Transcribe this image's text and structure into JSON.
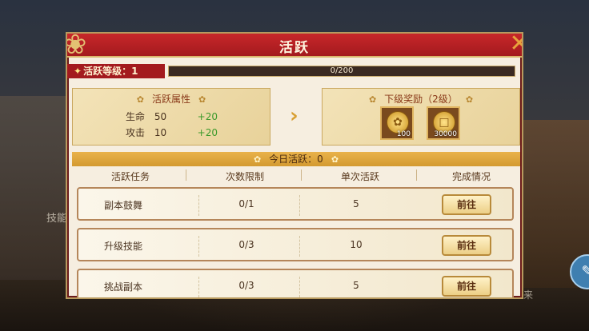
{
  "panel": {
    "title": "活跃",
    "close_icon": "close-x-icon"
  },
  "level": {
    "label": "活跃等级：1",
    "progress_text": "0/200",
    "progress_fraction": 0.0
  },
  "attributes": {
    "title": "活跃属性",
    "rows": [
      {
        "name": "生命",
        "value": "50",
        "increase": "+20"
      },
      {
        "name": "攻击",
        "value": "10",
        "increase": "+20"
      }
    ]
  },
  "rewards": {
    "title": "下级奖励（2级）",
    "items": [
      {
        "icon": "gold-flower-coin-icon",
        "quantity": "100"
      },
      {
        "icon": "gold-square-coin-icon",
        "quantity": "30000"
      }
    ]
  },
  "today": {
    "label": "今日活跃：0"
  },
  "table": {
    "headers": [
      "活跃任务",
      "次数限制",
      "单次活跃",
      "完成情况"
    ],
    "rows": [
      {
        "task": "副本鼓舞",
        "limit": "0/1",
        "points": "5",
        "action": "前往"
      },
      {
        "task": "升级技能",
        "limit": "0/3",
        "points": "10",
        "action": "前往"
      },
      {
        "task": "挑战副本",
        "limit": "0/3",
        "points": "5",
        "action": "前往"
      }
    ]
  },
  "background": {
    "side_text_left": "技能",
    "side_text_right": "来"
  },
  "colors": {
    "header_red": "#a31a1e",
    "gold": "#e9b24a",
    "increase_green": "#3c9a2c"
  }
}
